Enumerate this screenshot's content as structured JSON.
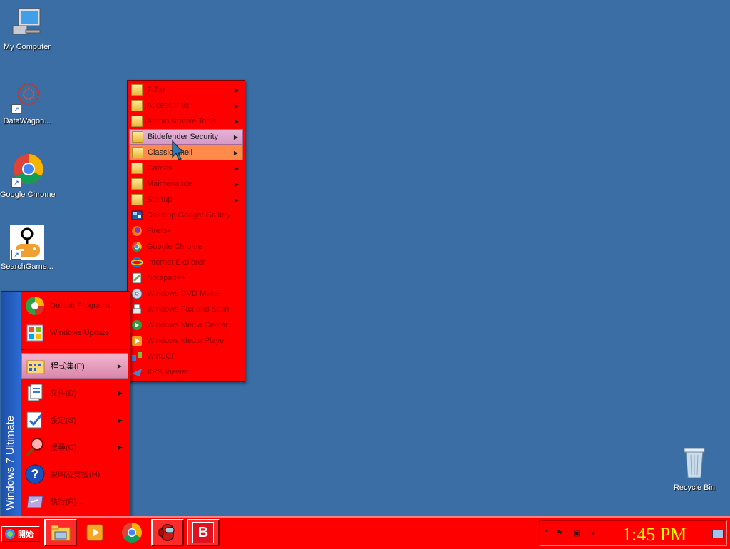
{
  "desktop": {
    "icons": [
      {
        "label": "My Computer",
        "icon": "computer-icon"
      },
      {
        "label": "DataWagon...",
        "icon": "datawagon-icon"
      },
      {
        "label": "Google Chrome",
        "icon": "chrome-icon"
      },
      {
        "label": "SearchGame...",
        "icon": "searchgame-icon"
      },
      {
        "label": "Recycle Bin",
        "icon": "recycle-bin-icon"
      }
    ]
  },
  "start_menu": {
    "banner": "Windows 7 Ultimate",
    "pinned": [
      {
        "label": "Default Programs",
        "icon": "default-programs-icon"
      },
      {
        "label": "Windows Update",
        "icon": "windows-update-icon"
      }
    ],
    "items": [
      {
        "label": "程式集(P)",
        "icon": "programs-icon",
        "has_submenu": true
      },
      {
        "label": "文件(D)",
        "icon": "documents-icon",
        "has_submenu": true
      },
      {
        "label": "設定(S)",
        "icon": "settings-icon",
        "has_submenu": true
      },
      {
        "label": "搜尋(C)",
        "icon": "search-icon",
        "has_submenu": true
      },
      {
        "label": "說明及支援(H)",
        "icon": "help-icon",
        "has_submenu": false
      },
      {
        "label": "執行(R)...",
        "icon": "run-icon",
        "has_submenu": false
      }
    ]
  },
  "programs_menu": {
    "items": [
      {
        "label": "7-Zip",
        "icon": "folder-icon",
        "submenu": true
      },
      {
        "label": "Accessories",
        "icon": "folder-icon",
        "submenu": true
      },
      {
        "label": "Administrative Tools",
        "icon": "folder-icon",
        "submenu": true
      },
      {
        "label": "Bitdefender Security",
        "icon": "folder-icon",
        "submenu": true
      },
      {
        "label": "Classic Shell",
        "icon": "folder-icon",
        "submenu": true
      },
      {
        "label": "Games",
        "icon": "folder-icon",
        "submenu": true
      },
      {
        "label": "Maintenance",
        "icon": "folder-icon",
        "submenu": true
      },
      {
        "label": "Startup",
        "icon": "folder-icon",
        "submenu": true
      },
      {
        "label": "Desktop Gadget Gallery",
        "icon": "gadget-gallery-icon",
        "submenu": false
      },
      {
        "label": "Firefox",
        "icon": "firefox-icon",
        "submenu": false
      },
      {
        "label": "Google Chrome",
        "icon": "chrome-icon",
        "submenu": false
      },
      {
        "label": "Internet Explorer",
        "icon": "internet-explorer-icon",
        "submenu": false
      },
      {
        "label": "Notepad++",
        "icon": "notepad-plus-plus-icon",
        "submenu": false
      },
      {
        "label": "Windows DVD Maker",
        "icon": "dvd-maker-icon",
        "submenu": false
      },
      {
        "label": "Windows Fax and Scan",
        "icon": "fax-scan-icon",
        "submenu": false
      },
      {
        "label": "Windows Media Center",
        "icon": "media-center-icon",
        "submenu": false
      },
      {
        "label": "Windows Media Player",
        "icon": "media-player-icon",
        "submenu": false
      },
      {
        "label": "WinSCP",
        "icon": "winscp-icon",
        "submenu": false
      },
      {
        "label": "XPS Viewer",
        "icon": "xps-viewer-icon",
        "submenu": false
      }
    ]
  },
  "taskbar": {
    "start_label": "開始",
    "buttons": [
      {
        "name": "file-explorer",
        "icon": "file-explorer-icon"
      },
      {
        "name": "media-player",
        "icon": "media-player-icon"
      },
      {
        "name": "google-chrome",
        "icon": "chrome-icon"
      },
      {
        "name": "among-us",
        "icon": "among-us-icon"
      },
      {
        "name": "bitdefender",
        "icon": "bitdefender-icon",
        "text": "B"
      }
    ],
    "clock": "1:45 PM"
  },
  "colors": {
    "desktop": "#3a6ea5",
    "menu": "#ff0000",
    "menu_text": "#8b0000",
    "hover": "#e7b3d7",
    "selected": "#ff8a4a",
    "clock": "#ffff00"
  }
}
